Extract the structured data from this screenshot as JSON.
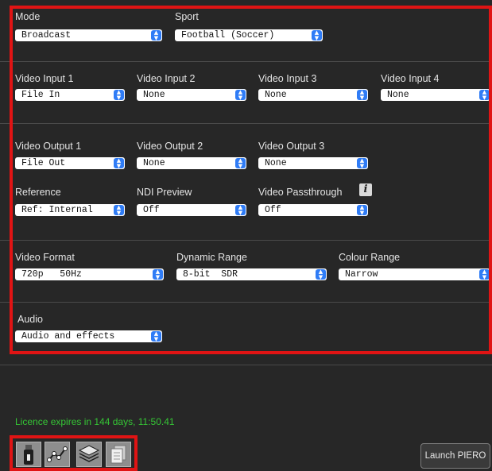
{
  "mode": {
    "label": "Mode",
    "value": "Broadcast"
  },
  "sport": {
    "label": "Sport",
    "value": "Football (Soccer)"
  },
  "video_inputs": [
    {
      "label": "Video Input 1",
      "value": "File In"
    },
    {
      "label": "Video Input 2",
      "value": "None"
    },
    {
      "label": "Video Input 3",
      "value": "None"
    },
    {
      "label": "Video Input 4",
      "value": "None"
    }
  ],
  "video_outputs": [
    {
      "label": "Video Output 1",
      "value": "File Out"
    },
    {
      "label": "Video Output 2",
      "value": "None"
    },
    {
      "label": "Video Output 3",
      "value": "None"
    }
  ],
  "reference": {
    "label": "Reference",
    "value": "Ref: Internal"
  },
  "ndi_preview": {
    "label": "NDI Preview",
    "value": "Off"
  },
  "video_passthrough": {
    "label": "Video Passthrough",
    "value": "Off",
    "info_glyph": "i"
  },
  "video_format": {
    "label": "Video Format",
    "value": "720p   50Hz"
  },
  "dynamic_range": {
    "label": "Dynamic Range",
    "value": "8-bit  SDR"
  },
  "colour_range": {
    "label": "Colour Range",
    "value": "Narrow"
  },
  "audio": {
    "label": "Audio",
    "value": "Audio and effects"
  },
  "licence": {
    "text": "Licence expires in 144 days, 11:50.41"
  },
  "toolbar": {
    "icons": [
      "usb-drive-icon",
      "graph-nodes-icon",
      "layers-icon",
      "documents-icon"
    ]
  },
  "launch_button": {
    "label": "Launch PIERO"
  },
  "colors": {
    "highlight": "#e01414",
    "licence_text": "#35c535",
    "select_arrow": "#2f7cf6"
  }
}
